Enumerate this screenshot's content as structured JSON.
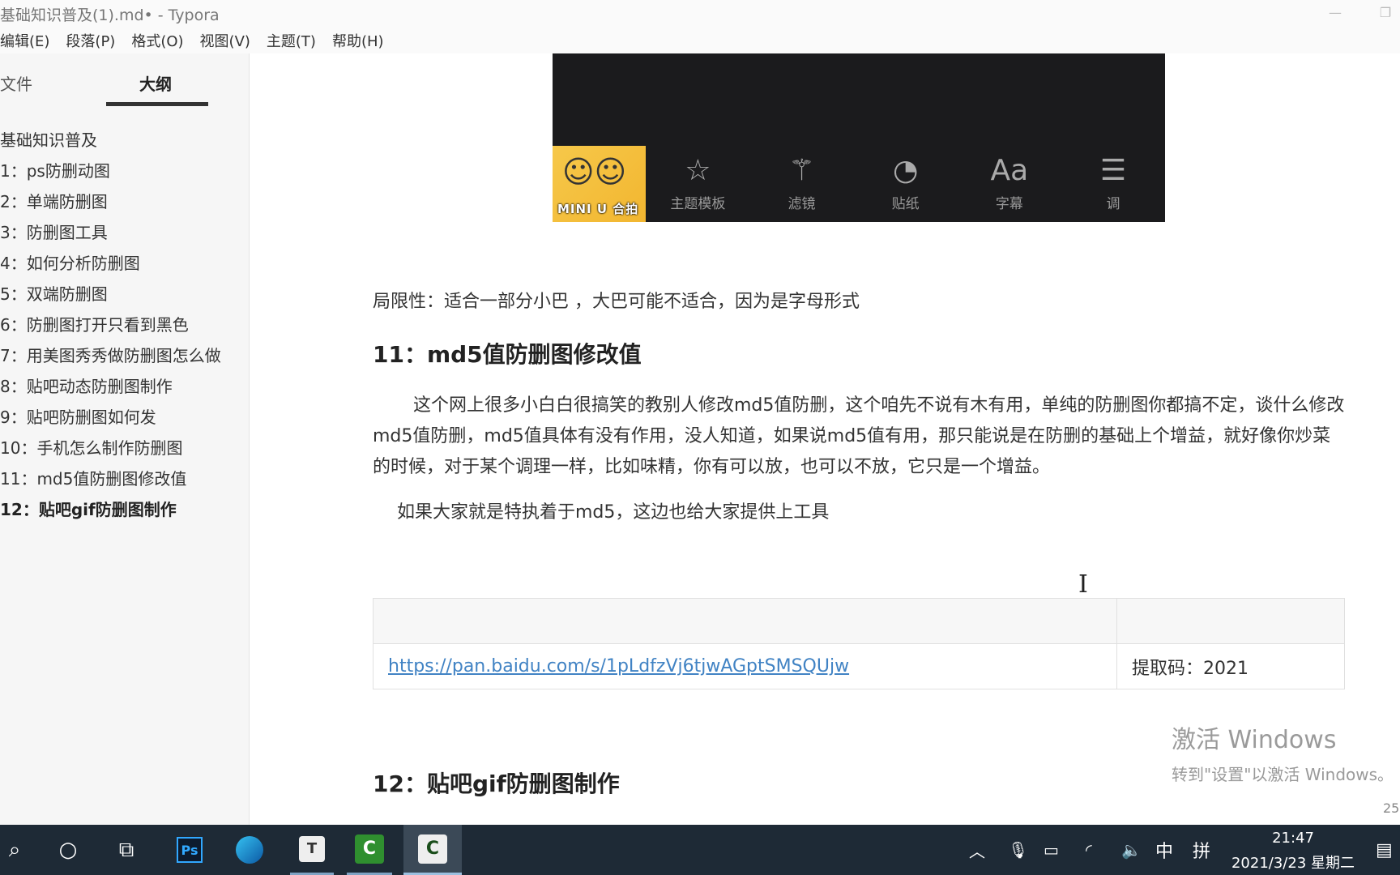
{
  "window": {
    "title": "基础知识普及(1).md• - Typora",
    "minimize_glyph": "—",
    "maximize_glyph": "❐"
  },
  "menu": [
    "编辑(E)",
    "段落(P)",
    "格式(O)",
    "视图(V)",
    "主题(T)",
    "帮助(H)"
  ],
  "sidebar": {
    "tabs": {
      "files": "文件",
      "outline": "大纲"
    },
    "outline": [
      "基础知识普及",
      "1：ps防删动图",
      "2：单端防删图",
      "3：防删图工具",
      "4：如何分析防删图",
      "5：双端防删图",
      "6：防删图打开只看到黑色",
      "7：用美图秀秀做防删图怎么做",
      "8：贴吧动态防删图制作",
      "9：贴吧防删图如何发",
      "10：手机怎么制作防删图",
      "11：md5值防删图修改值",
      "12：贴吧gif防删图制作"
    ],
    "active_index": 12,
    "nav_prev": "<",
    "nav_source": "</>"
  },
  "app_image": {
    "miniu_label": "MINI U 合拍",
    "tools": [
      {
        "icon": "star-icon",
        "glyph": "☆",
        "label": "主题模板"
      },
      {
        "icon": "magic-wand-icon",
        "glyph": "⚚",
        "label": "滤镜"
      },
      {
        "icon": "sticker-icon",
        "glyph": "◔",
        "label": "贴纸"
      },
      {
        "icon": "text-icon",
        "glyph": "Aa",
        "label": "字幕"
      },
      {
        "icon": "adjust-icon",
        "glyph": "☰",
        "label": "调"
      }
    ]
  },
  "content": {
    "limit_text": "局限性：适合一部分小巴 ，大巴可能不适合，因为是字母形式",
    "heading_11": "11：md5值防删图修改值",
    "body_paragraph": "这个网上很多小白白很搞笑的教别人修改md5值防删，这个咱先不说有木有用，单纯的防删图你都搞不定，谈什么修改md5值防删，md5值具体有没有作用，没人知道，如果说md5值有用，那只能说是在防删的基础上个增益，就好像你炒菜的时候，对于某个调理一样，比如味精，你有可以放，也可以不放，它只是一个增益。",
    "body_paragraph2": "如果大家就是特执着于md5，这边也给大家提供上工具",
    "table": {
      "link": "https://pan.baidu.com/s/1pLdfzVj6tjwAGptSMSQUjw",
      "code": "提取码：2021"
    },
    "heading_12": "12：贴吧gif防删图制作"
  },
  "watermark": {
    "line1": "激活 Windows",
    "line2": "转到\"设置\"以激活 Windows。"
  },
  "status": {
    "word_count": "25"
  },
  "taskbar": {
    "ps_label": "Ps",
    "typora_label": "T",
    "camtasia_label": "C",
    "ime_mode": "中",
    "ime_layout": "拼",
    "time": "21:47",
    "date": "2021/3/23 星期二"
  },
  "colors": {
    "link": "#4183c4",
    "taskbar": "#1e2a36",
    "sidebar": "#f6f6f6"
  }
}
